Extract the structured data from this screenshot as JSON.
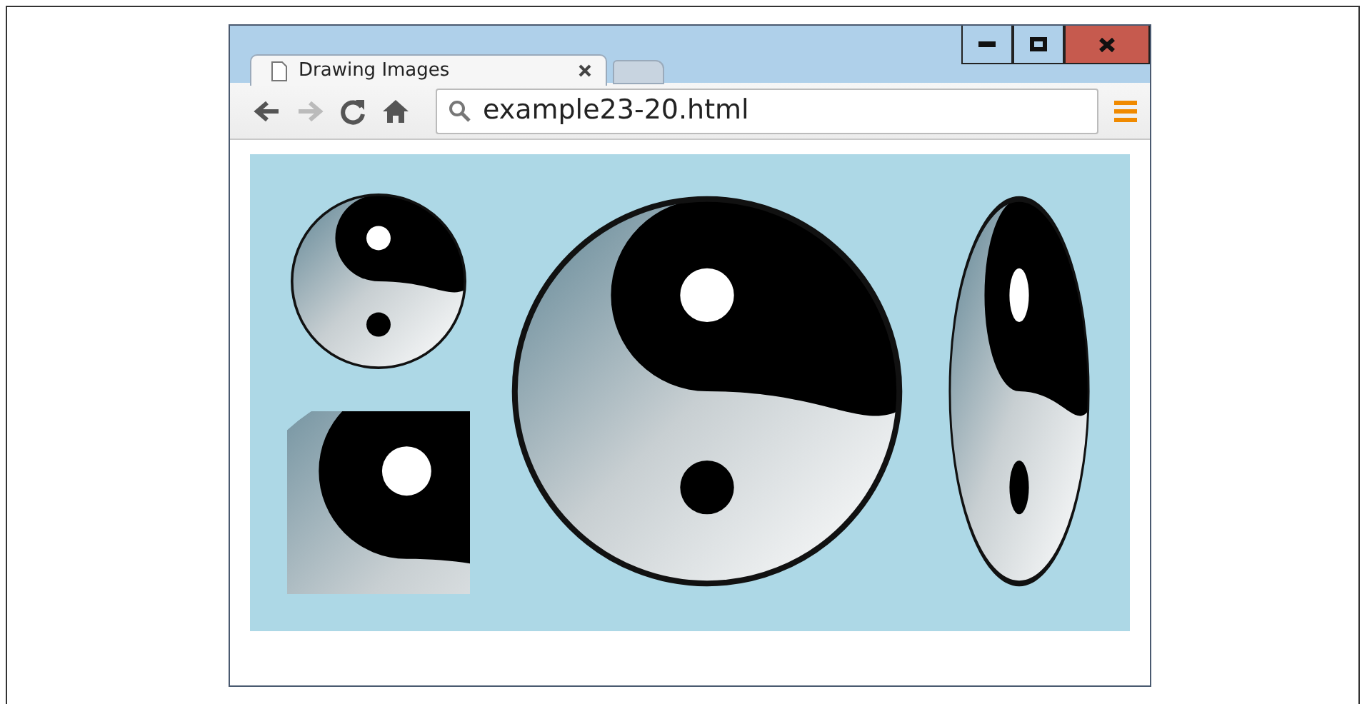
{
  "window": {
    "tab": {
      "title": "Drawing Images",
      "selected": true
    },
    "address": {
      "value": "example23-20.html"
    },
    "nav": {
      "back_disabled": false,
      "forward_disabled": true
    }
  }
}
